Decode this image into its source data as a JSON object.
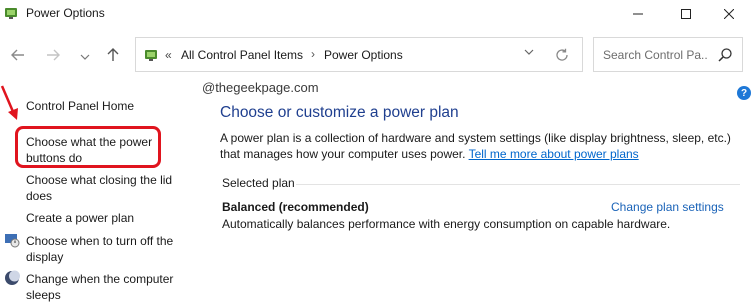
{
  "window": {
    "title": "Power Options"
  },
  "address_bar": {
    "overflow_marker": "«",
    "crumbs": [
      "All Control Panel Items",
      "Power Options"
    ],
    "separator": "›"
  },
  "search": {
    "placeholder": "Search Control Pa..."
  },
  "left_pane": {
    "items": [
      {
        "label": "Control Panel Home"
      },
      {
        "label": "Choose what the power buttons do"
      },
      {
        "label": "Choose what closing the lid does"
      },
      {
        "label": "Create a power plan"
      },
      {
        "label": "Choose when to turn off the display"
      },
      {
        "label": "Change when the computer sleeps"
      }
    ]
  },
  "watermark": "@thegeekpage.com",
  "main": {
    "heading": "Choose or customize a power plan",
    "description": "A power plan is a collection of hardware and system settings (like display brightness, sleep, etc.) that manages how your computer uses power.",
    "learn_more_link": "Tell me more about power plans",
    "selected_label": "Selected plan",
    "plan_name": "Balanced (recommended)",
    "change_link": "Change plan settings",
    "plan_description": "Automatically balances performance with energy consumption on capable hardware."
  },
  "colors": {
    "accent_link": "#0066cc",
    "highlight": "#e0141e",
    "heading": "#1f3f8f"
  }
}
